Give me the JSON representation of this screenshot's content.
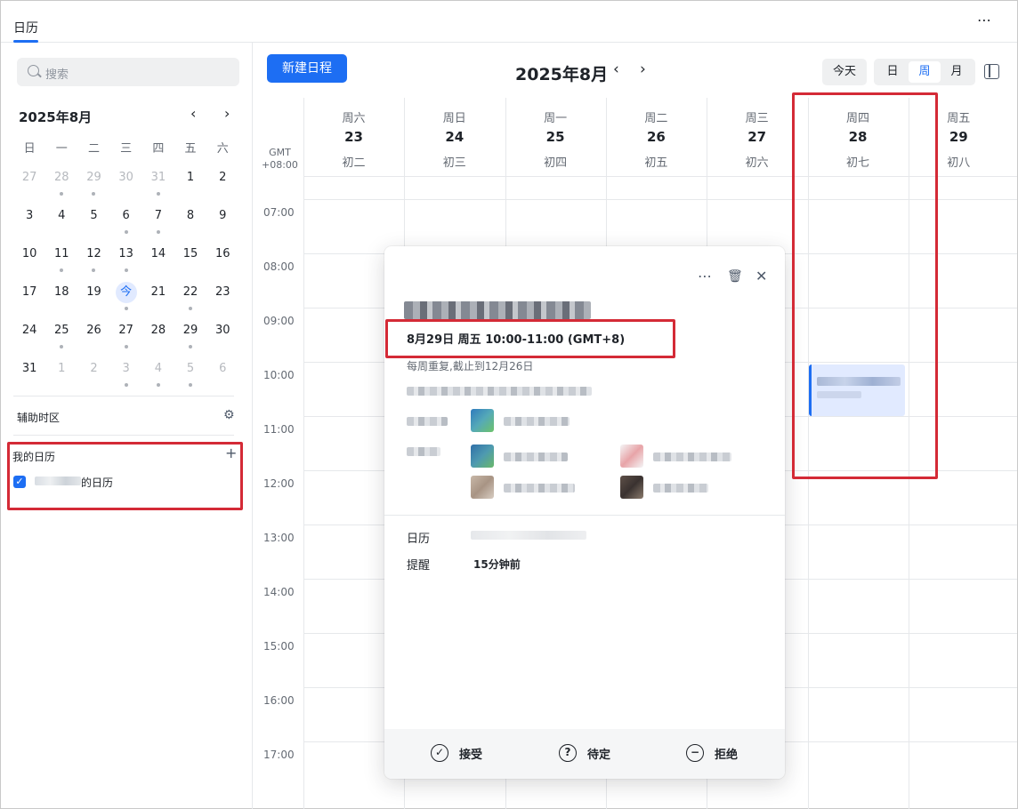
{
  "app": {
    "tab_label": "日历",
    "more_icon": "⋯"
  },
  "sidebar": {
    "search_placeholder": "搜索",
    "mini_calendar": {
      "title": "2025年8月",
      "prev": "‹",
      "next": "›",
      "weekdays": [
        "日",
        "一",
        "二",
        "三",
        "四",
        "五",
        "六"
      ],
      "weeks": [
        [
          {
            "d": "27",
            "dim": true,
            "dot": false
          },
          {
            "d": "28",
            "dim": true,
            "dot": true
          },
          {
            "d": "29",
            "dim": true,
            "dot": true
          },
          {
            "d": "30",
            "dim": true,
            "dot": false
          },
          {
            "d": "31",
            "dim": true,
            "dot": true
          },
          {
            "d": "1",
            "dim": false,
            "dot": false
          },
          {
            "d": "2",
            "dim": false,
            "dot": false
          }
        ],
        [
          {
            "d": "3",
            "dim": false,
            "dot": false
          },
          {
            "d": "4",
            "dim": false,
            "dot": false
          },
          {
            "d": "5",
            "dim": false,
            "dot": false
          },
          {
            "d": "6",
            "dim": false,
            "dot": true
          },
          {
            "d": "7",
            "dim": false,
            "dot": true
          },
          {
            "d": "8",
            "dim": false,
            "dot": false
          },
          {
            "d": "9",
            "dim": false,
            "dot": false
          }
        ],
        [
          {
            "d": "10",
            "dim": false,
            "dot": false
          },
          {
            "d": "11",
            "dim": false,
            "dot": true
          },
          {
            "d": "12",
            "dim": false,
            "dot": true
          },
          {
            "d": "13",
            "dim": false,
            "dot": true
          },
          {
            "d": "14",
            "dim": false,
            "dot": false
          },
          {
            "d": "15",
            "dim": false,
            "dot": false
          },
          {
            "d": "16",
            "dim": false,
            "dot": false
          }
        ],
        [
          {
            "d": "17",
            "dim": false,
            "dot": false
          },
          {
            "d": "18",
            "dim": false,
            "dot": false
          },
          {
            "d": "19",
            "dim": false,
            "dot": false
          },
          {
            "d": "今",
            "dim": false,
            "dot": true,
            "today": true
          },
          {
            "d": "21",
            "dim": false,
            "dot": false
          },
          {
            "d": "22",
            "dim": false,
            "dot": true
          },
          {
            "d": "23",
            "dim": false,
            "dot": false
          }
        ],
        [
          {
            "d": "24",
            "dim": false,
            "dot": false
          },
          {
            "d": "25",
            "dim": false,
            "dot": true
          },
          {
            "d": "26",
            "dim": false,
            "dot": false
          },
          {
            "d": "27",
            "dim": false,
            "dot": true
          },
          {
            "d": "28",
            "dim": false,
            "dot": false
          },
          {
            "d": "29",
            "dim": false,
            "dot": true
          },
          {
            "d": "30",
            "dim": false,
            "dot": false
          }
        ],
        [
          {
            "d": "31",
            "dim": false,
            "dot": false
          },
          {
            "d": "1",
            "dim": true,
            "dot": false
          },
          {
            "d": "2",
            "dim": true,
            "dot": false
          },
          {
            "d": "3",
            "dim": true,
            "dot": true
          },
          {
            "d": "4",
            "dim": true,
            "dot": true
          },
          {
            "d": "5",
            "dim": true,
            "dot": true
          },
          {
            "d": "6",
            "dim": true,
            "dot": false
          }
        ]
      ]
    },
    "aux_timezone_label": "辅助时区",
    "my_calendars_label": "我的日历",
    "calendar_item_suffix": "的日历"
  },
  "toolbar": {
    "new_event": "新建日程",
    "month_title": "2025年8月",
    "prev": "‹",
    "next": "›",
    "today": "今天",
    "views": [
      "日",
      "周",
      "月"
    ],
    "active_view": "周"
  },
  "week": {
    "gmt_line1": "GMT",
    "gmt_line2": "+08:00",
    "days": [
      {
        "weekday": "周六",
        "date": "23",
        "lunar": "初二"
      },
      {
        "weekday": "周日",
        "date": "24",
        "lunar": "初三"
      },
      {
        "weekday": "周一",
        "date": "25",
        "lunar": "初四"
      },
      {
        "weekday": "周二",
        "date": "26",
        "lunar": "初五"
      },
      {
        "weekday": "周三",
        "date": "27",
        "lunar": "初六"
      },
      {
        "weekday": "周四",
        "date": "28",
        "lunar": "初七"
      },
      {
        "weekday": "周五",
        "date": "29",
        "lunar": "初八"
      }
    ],
    "hours": [
      "07:00",
      "08:00",
      "09:00",
      "10:00",
      "11:00",
      "12:00",
      "13:00",
      "14:00",
      "15:00",
      "16:00",
      "17:00"
    ]
  },
  "popover": {
    "more": "⋯",
    "delete": "🗑",
    "close": "✕",
    "time": "8月29日 周五 10:00-11:00 (GMT+8)",
    "repeat": "每周重复,截止到12月26日",
    "calendar_key": "日历",
    "reminder_key": "提醒",
    "reminder_value": "15分钟前",
    "accept": "接受",
    "tentative": "待定",
    "decline": "拒绝"
  },
  "colors": {
    "accent": "#1d6ef3",
    "annotation_red": "#d42a36"
  }
}
